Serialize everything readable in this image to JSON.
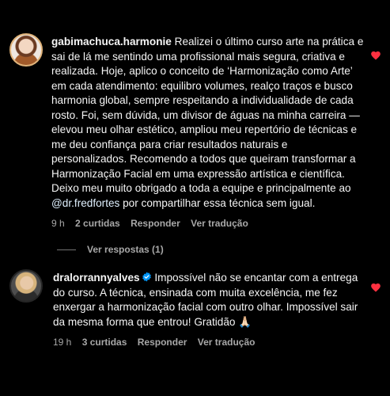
{
  "comments": [
    {
      "username": "gabimachuca.harmonie",
      "text_before_mention": "Realizei o último curso arte na prática e sai de lá me sentindo uma profissional mais segura, criativa e realizada. Hoje, aplico o conceito de ‘Harmonização como Arte’ em cada atendimento: equilibro volumes, realço traços e busco harmonia global, sempre respeitando a individualidade de cada rosto. Foi, sem dúvida, um divisor de águas na minha carreira — elevou meu olhar estético, ampliou meu repertório de técnicas e me deu confiança para criar resultados naturais e personalizados. Recomendo a todos que queiram transformar a Harmonização Facial em uma expressão artística e científica. Deixo meu muito obrigado a toda a equipe e principalmente ao",
      "mention": "@dr.fredfortes",
      "text_after_mention": "por compartilhar essa técnica sem igual.",
      "time": "9 h",
      "likes": "2 curtidas",
      "reply_label": "Responder",
      "translate_label": "Ver tradução",
      "liked": true,
      "verified": false,
      "avatar_icon": "profile-photo"
    },
    {
      "username": "dralorrannyalves",
      "text": "Impossível não se encantar com a entrega do curso. A técnica, ensinada com muita excelência, me fez enxergar a harmonização facial com outro olhar. Impossível sair da mesma forma que entrou! Gratidão 🙏🏻",
      "time": "19 h",
      "likes": "3 curtidas",
      "reply_label": "Responder",
      "translate_label": "Ver tradução",
      "liked": true,
      "verified": true,
      "avatar_icon": "profile-photo"
    }
  ],
  "view_replies_label": "Ver respostas (1)",
  "colors": {
    "background": "#000000",
    "text": "#f5f5f5",
    "secondary_text": "#a8a8a8",
    "like_red": "#ff3040",
    "verified_blue": "#0095f6",
    "mention": "#e0f1ff"
  },
  "icons": [
    "heart-icon",
    "verified-badge-icon"
  ]
}
